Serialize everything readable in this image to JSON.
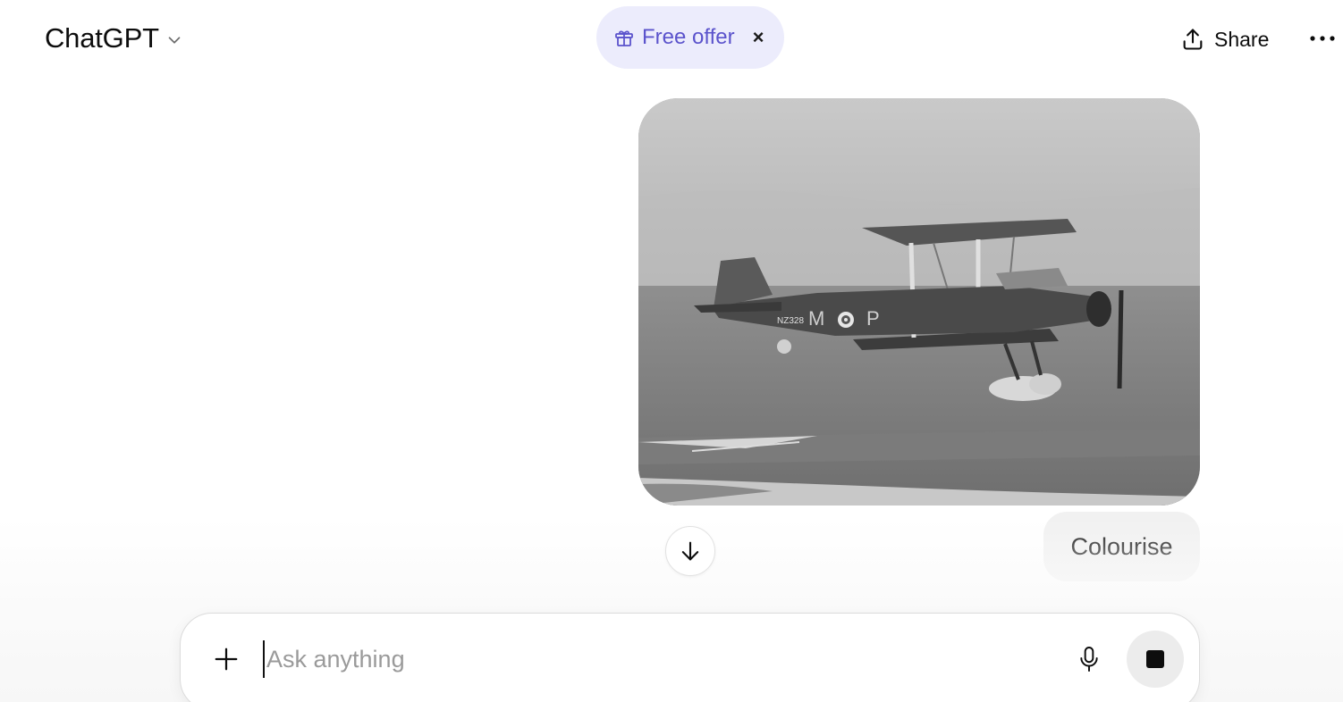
{
  "header": {
    "model_name": "ChatGPT",
    "model_switcher_icon": "chevron-down-icon",
    "offer": {
      "icon": "gift-icon",
      "label": "Free offer",
      "close": "×",
      "accent": "#5b53cc",
      "background": "#ececfc"
    },
    "share": {
      "icon": "share-icon",
      "label": "Share"
    },
    "more_icon": "ellipsis-icon"
  },
  "conversation": {
    "image_message": {
      "alt": "Black-and-white photo of a biplane flying over the sea",
      "fuselage_markings": [
        "M",
        "P"
      ],
      "serial": "NZ328"
    },
    "user_message": "Colourise",
    "scroll_down_icon": "arrow-down-icon"
  },
  "composer": {
    "placeholder": "Ask anything",
    "value": "",
    "plus_icon": "plus-icon",
    "mic_icon": "microphone-icon",
    "stop_icon": "stop-icon"
  }
}
